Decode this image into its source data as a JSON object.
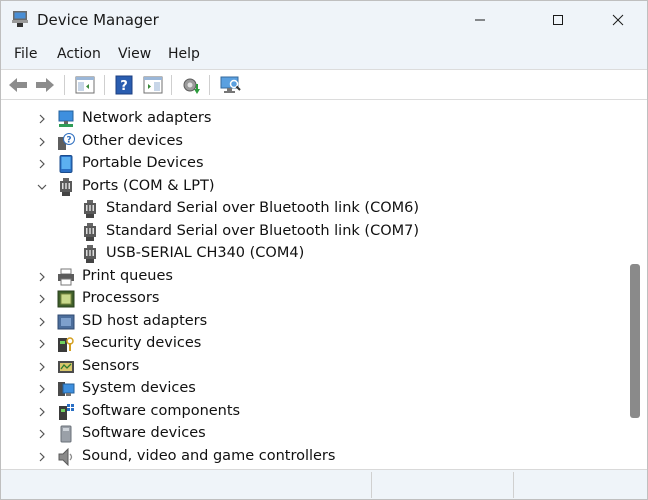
{
  "window": {
    "title": "Device Manager"
  },
  "titlebar": {
    "app_icon": "device-manager-icon",
    "min_icon": "minimize-icon",
    "max_icon": "maximize-icon",
    "close_icon": "close-icon"
  },
  "menu": {
    "items": [
      "File",
      "Action",
      "View",
      "Help"
    ]
  },
  "toolbar": {
    "buttons": [
      "back-arrow-icon",
      "forward-arrow-icon",
      "show-hide-console-tree-icon",
      "help-icon",
      "show-action-pane-icon",
      "update-driver-icon",
      "scan-hardware-changes-icon"
    ]
  },
  "tree": {
    "items": [
      {
        "label": "Network adapters",
        "icon": "network-adapter-icon",
        "expanded": false,
        "level": 0
      },
      {
        "label": "Other devices",
        "icon": "other-devices-icon",
        "expanded": false,
        "level": 0
      },
      {
        "label": "Portable Devices",
        "icon": "portable-device-icon",
        "expanded": false,
        "level": 0
      },
      {
        "label": "Ports (COM & LPT)",
        "icon": "port-icon",
        "expanded": true,
        "level": 0
      },
      {
        "label": "Standard Serial over Bluetooth link (COM6)",
        "icon": "port-icon",
        "level": 1
      },
      {
        "label": "Standard Serial over Bluetooth link (COM7)",
        "icon": "port-icon",
        "level": 1
      },
      {
        "label": "USB-SERIAL CH340 (COM4)",
        "icon": "port-icon",
        "level": 1
      },
      {
        "label": "Print queues",
        "icon": "printer-icon",
        "expanded": false,
        "level": 0
      },
      {
        "label": "Processors",
        "icon": "processor-icon",
        "expanded": false,
        "level": 0
      },
      {
        "label": "SD host adapters",
        "icon": "sd-host-icon",
        "expanded": false,
        "level": 0
      },
      {
        "label": "Security devices",
        "icon": "security-device-icon",
        "expanded": false,
        "level": 0
      },
      {
        "label": "Sensors",
        "icon": "sensor-icon",
        "expanded": false,
        "level": 0
      },
      {
        "label": "System devices",
        "icon": "system-device-icon",
        "expanded": false,
        "level": 0
      },
      {
        "label": "Software components",
        "icon": "software-component-icon",
        "expanded": false,
        "level": 0
      },
      {
        "label": "Software devices",
        "icon": "software-device-icon",
        "expanded": false,
        "level": 0
      },
      {
        "label": "Sound, video and game controllers",
        "icon": "sound-icon",
        "expanded": false,
        "level": 0
      }
    ]
  },
  "scrollbar": {
    "thumb_fraction": 0.42
  },
  "colors": {
    "titlebar_bg": "#eff4f9",
    "accent_blue": "#1a73c8",
    "scroll_thumb": "#8a8a8a"
  }
}
